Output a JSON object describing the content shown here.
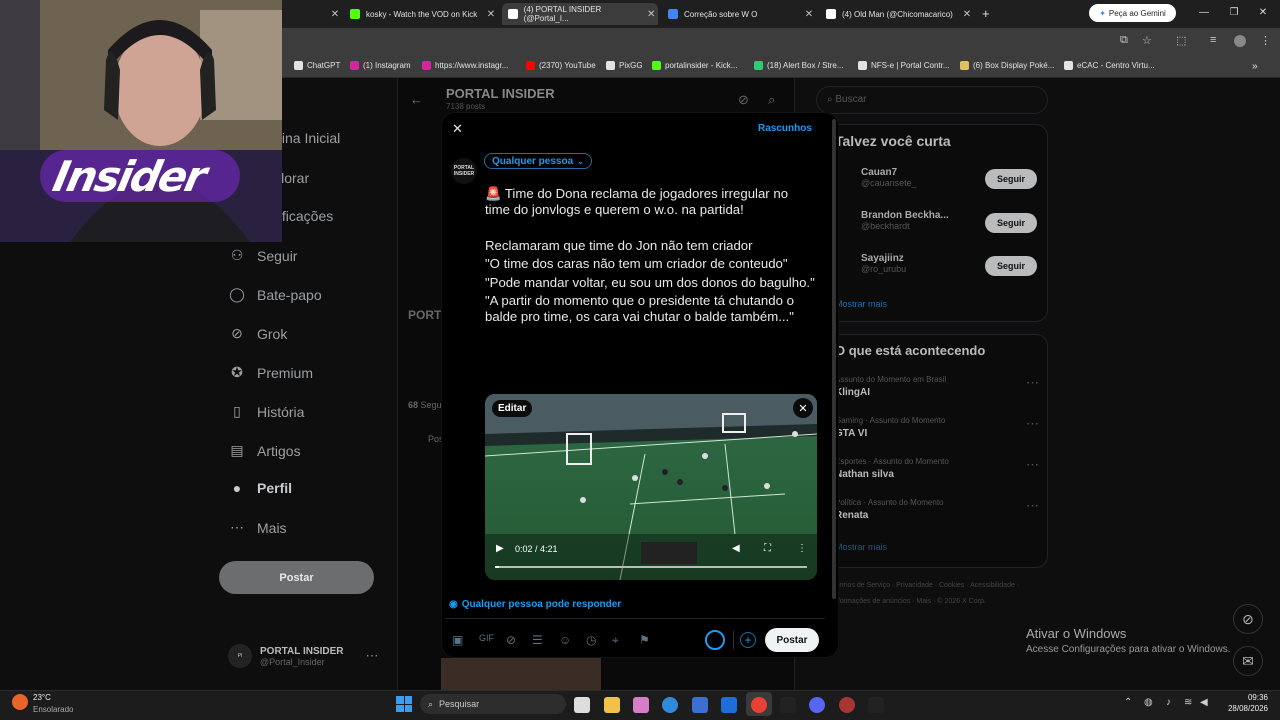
{
  "browser": {
    "tabs": [
      {
        "label": "kosky - Watch the VOD on Kick",
        "color": "#53fc18"
      },
      {
        "label": "(4) PORTAL INSIDER (@Portal_I...",
        "color": "#ffffff"
      },
      {
        "label": "Correção sobre W O",
        "color": "#4285f4"
      },
      {
        "label": "(4) Old Man (@Chicomacarico)",
        "color": "#ffffff"
      }
    ],
    "gemini_button": "Peça ao Gemini",
    "bookmarks": [
      "ChatGPT",
      "(1) Instagram",
      "https://www.instagr...",
      "(2370) YouTube",
      "PixGG",
      "portalinsider - Kick...",
      "(18) Alert Box / Stre...",
      "NFS-e | Portal Contr...",
      "(6) Box Display Poké...",
      "eCAC - Centro Virtu..."
    ]
  },
  "sidebar": {
    "items": [
      "Página Inicial",
      "Explorar",
      "Notificações",
      "Seguir",
      "Bate-papo",
      "Grok",
      "Premium",
      "História",
      "Artigos",
      "Perfil",
      "Mais"
    ],
    "post_button": "Postar",
    "account_name": "PORTAL INSIDER",
    "account_handle": "@Portal_Insider"
  },
  "profile": {
    "name": "PORTAL INSIDER",
    "posts": "7138 posts",
    "following": "68",
    "following_label": "Seguindo",
    "tab": "Posts"
  },
  "right": {
    "search_placeholder": "Buscar",
    "who_to_follow": "Talvez você curta",
    "users": [
      {
        "name": "Cauan7",
        "handle": "@cauansete_"
      },
      {
        "name": "Brandon Beckha...",
        "handle": "@beckhardt"
      },
      {
        "name": "Sayajiinz",
        "handle": "@ro_urubu"
      }
    ],
    "follow_label": "Seguir",
    "show_more": "Mostrar mais",
    "happening": "O que está acontecendo",
    "trends": [
      {
        "context": "Assunto do Momento em Brasil",
        "name": "KlingAI"
      },
      {
        "context": "Gaming · Assunto do Momento",
        "name": "GTA VI"
      },
      {
        "context": "Esportes · Assunto do Momento",
        "name": "Nathan silva"
      },
      {
        "context": "Política · Assunto do Momento",
        "name": "Renata"
      }
    ],
    "footer": "Termos de Serviço · Privacidade · Cookies · Acessibilidade · Informações de anúncios · Mais · © 2026 X Corp."
  },
  "composer": {
    "drafts": "Rascunhos",
    "audience": "Qualquer pessoa",
    "text_lines": [
      "🚨 Time do Dona reclama de jogadores irregular no time do jonvlogs e querem o w.o. na partida!",
      "",
      "Reclamaram que time do Jon não tem criador",
      "\"O time dos caras não tem um criador de conteudo\"",
      "\"Pode mandar voltar, eu sou um dos donos do bagulho.\"",
      "\"A partir do momento que o presidente tá chutando o balde pro time, os cara vai chutar o balde também...\""
    ],
    "video_edit": "Editar",
    "video_time": "0:02 / 4:21",
    "reply_setting": "Qualquer pessoa pode responder",
    "post_button": "Postar"
  },
  "windows_watermark": {
    "title": "Ativar o Windows",
    "subtitle": "Acesse Configurações para ativar o Windows."
  },
  "taskbar": {
    "weather_temp": "23°C",
    "weather_desc": "Ensolarado",
    "search": "Pesquisar",
    "time": "09:36",
    "date": "28/08/2026"
  },
  "overlay": {
    "logo_text": "Insider"
  }
}
